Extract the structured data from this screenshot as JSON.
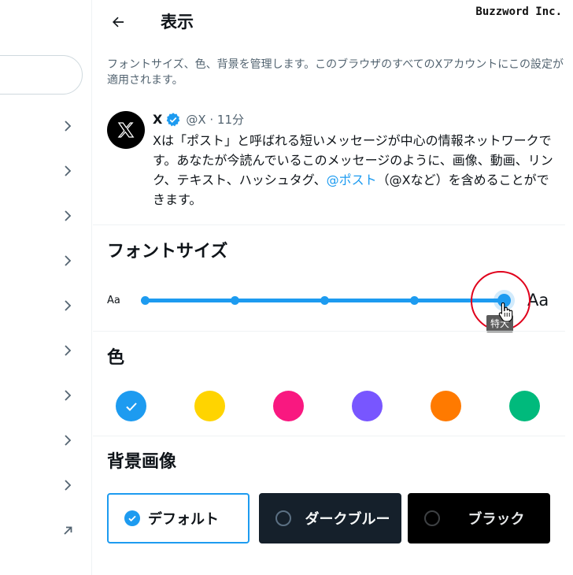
{
  "header": {
    "title": "表示",
    "back_icon": "arrow-left-icon",
    "brand": "Buzzword Inc."
  },
  "description": "フォントサイズ、色、背景を管理します。このブラウザのすべてのXアカウントにこの設定が適用されます。",
  "sample_post": {
    "name": "X",
    "verified": true,
    "meta": "@X · 11分",
    "text_before": "Xは「ポスト」と呼ばれる短いメッセージが中心の情報ネットワークです。あなたが今読んでいるこのメッセージのように、画像、動画、リンク、テキスト、ハッシュタグ、",
    "mention": "@ポスト",
    "text_after": "（@Xなど）を含めることができます。"
  },
  "font_size": {
    "title": "フォントサイズ",
    "small_label": "Aa",
    "large_label": "Aa",
    "steps": 5,
    "selected_index": 4,
    "tooltip": "特大"
  },
  "colors": {
    "title": "色",
    "swatches": [
      "#1d9bf0",
      "#ffd400",
      "#f91880",
      "#7856ff",
      "#ff7a00",
      "#00ba7c"
    ],
    "selected_index": 0
  },
  "background": {
    "title": "背景画像",
    "options": [
      {
        "label": "デフォルト",
        "selected": true
      },
      {
        "label": "ダークブルー",
        "selected": false
      },
      {
        "label": "ブラック",
        "selected": false
      }
    ]
  },
  "left_nav": {
    "chevron_count": 9,
    "last_icon": "external-link-arrow-icon"
  },
  "accent_color": "#1d9bf0"
}
